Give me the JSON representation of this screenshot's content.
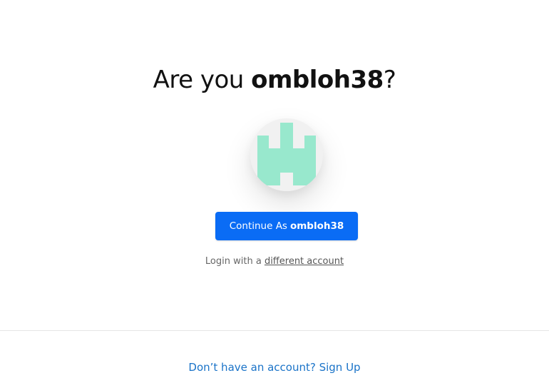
{
  "title": {
    "prefix": "Are you ",
    "username": "ombloh38",
    "suffix": "?"
  },
  "avatar": {
    "icon": "castle-icon",
    "color": "#98e8cd",
    "background": "#f1f1f1"
  },
  "continue_button": {
    "prefix": "Continue As ",
    "username": "ombloh38",
    "color": "#0a6cf5"
  },
  "alt_login": {
    "prefix": "Login with a ",
    "link": "different account"
  },
  "signup": {
    "text": "Don’t have an account? Sign Up",
    "color": "#1a73c8"
  }
}
